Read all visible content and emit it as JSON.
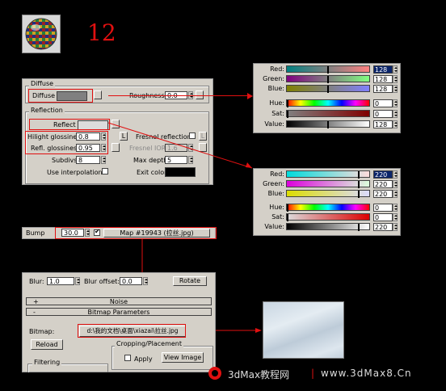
{
  "step_number": "12",
  "colors": {
    "background": "#000000",
    "step_number": "#e01010",
    "panel": "#d4d0c8",
    "accent": "#e01010"
  },
  "material_preview_icon": "sphere-material-preview-icon",
  "material": {
    "diffuse_group": "Diffuse",
    "diffuse_label": "Diffuse",
    "roughness_label": "Roughness",
    "roughness_value": "0.0",
    "reflection_group": "Reflection",
    "reflect_label": "Reflect",
    "hilight_label": "Hilight glossiness",
    "hilight_value": "0.8",
    "hilight_lock": "L",
    "refl_gloss_label": "Refl. glossiness",
    "refl_gloss_value": "0.95",
    "subdivs_label": "Subdivs",
    "subdivs_value": "8",
    "interp_label": "Use interpolation",
    "fresnel_label": "Fresnel reflections",
    "fresnel_lock": "L",
    "fresnel_ior_label": "Fresnel IOR",
    "fresnel_ior_value": "1.6",
    "max_depth_label": "Max depth",
    "max_depth_value": "5",
    "exit_color_label": "Exit color"
  },
  "picker_top": {
    "rows": [
      {
        "label": "Red:",
        "value": "128"
      },
      {
        "label": "Green:",
        "value": "128"
      },
      {
        "label": "Blue:",
        "value": "128"
      },
      {
        "label": "Hue:",
        "value": "0"
      },
      {
        "label": "Sat:",
        "value": "0"
      },
      {
        "label": "Value:",
        "value": "128"
      }
    ]
  },
  "picker_bottom": {
    "rows": [
      {
        "label": "Red:",
        "value": "220"
      },
      {
        "label": "Green:",
        "value": "220"
      },
      {
        "label": "Blue:",
        "value": "220"
      },
      {
        "label": "Hue:",
        "value": "0"
      },
      {
        "label": "Sat:",
        "value": "0"
      },
      {
        "label": "Value:",
        "value": "220"
      }
    ]
  },
  "bump": {
    "label": "Bump",
    "value": "30.0",
    "map_label": "Map #19943 (拉丝.jpg)"
  },
  "bitmap_panel": {
    "blur_label": "Blur:",
    "blur_value": "1.0",
    "blur_offset_label": "Blur offset:",
    "blur_offset_value": "0.0",
    "rotate_label": "Rotate",
    "noise_rollout": "Noise",
    "noise_sign": "+",
    "bitmap_rollout": "Bitmap Parameters",
    "bitmap_sign": "-",
    "bitmap_label": "Bitmap:",
    "bitmap_path": "d:\\我的文档\\桌面\\xiazai\\拉丝.jpg",
    "reload_label": "Reload",
    "cropping_label": "Cropping/Placement",
    "apply_label": "Apply",
    "view_image_label": "View Image",
    "filtering_label": "Filtering"
  },
  "footer": {
    "site_name": "3dMax教程网",
    "separator": "|",
    "url": "www.3dMax8.Cn"
  }
}
